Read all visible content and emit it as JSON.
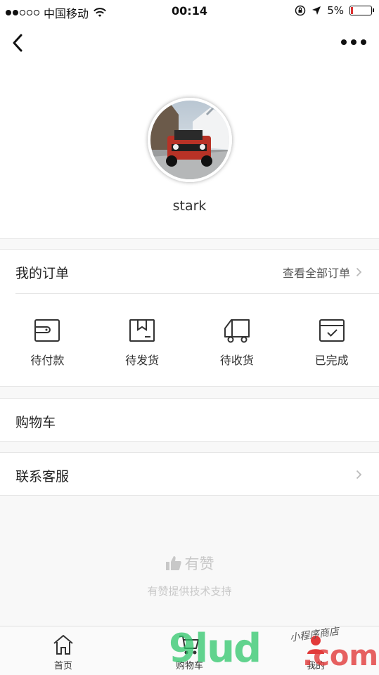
{
  "status_bar": {
    "carrier": "中国移动",
    "time": "00:14",
    "battery": "5%"
  },
  "profile": {
    "username": "stark"
  },
  "orders": {
    "title": "我的订单",
    "view_all": "查看全部订单",
    "items": [
      {
        "label": "待付款",
        "icon": "wallet-icon"
      },
      {
        "label": "待发货",
        "icon": "package-icon"
      },
      {
        "label": "待收货",
        "icon": "truck-icon"
      },
      {
        "label": "已完成",
        "icon": "completed-box-icon"
      }
    ]
  },
  "cart_row": {
    "title": "购物车"
  },
  "service_row": {
    "title": "联系客服"
  },
  "brand": {
    "name": "有赞",
    "tagline": "有赞提供技术支持"
  },
  "tabbar": {
    "tabs": [
      {
        "label": "首页",
        "icon": "home-icon"
      },
      {
        "label": "购物车",
        "icon": "cart-icon"
      },
      {
        "label": "我的",
        "icon": "profile-icon"
      }
    ]
  },
  "watermark": {
    "text": "9lud",
    "domain": ".com",
    "tag": "小程序商店"
  },
  "colors": {
    "watermark_green": "#2ec76b",
    "watermark_red": "#e23a3a",
    "low_battery": "#dd3333"
  }
}
